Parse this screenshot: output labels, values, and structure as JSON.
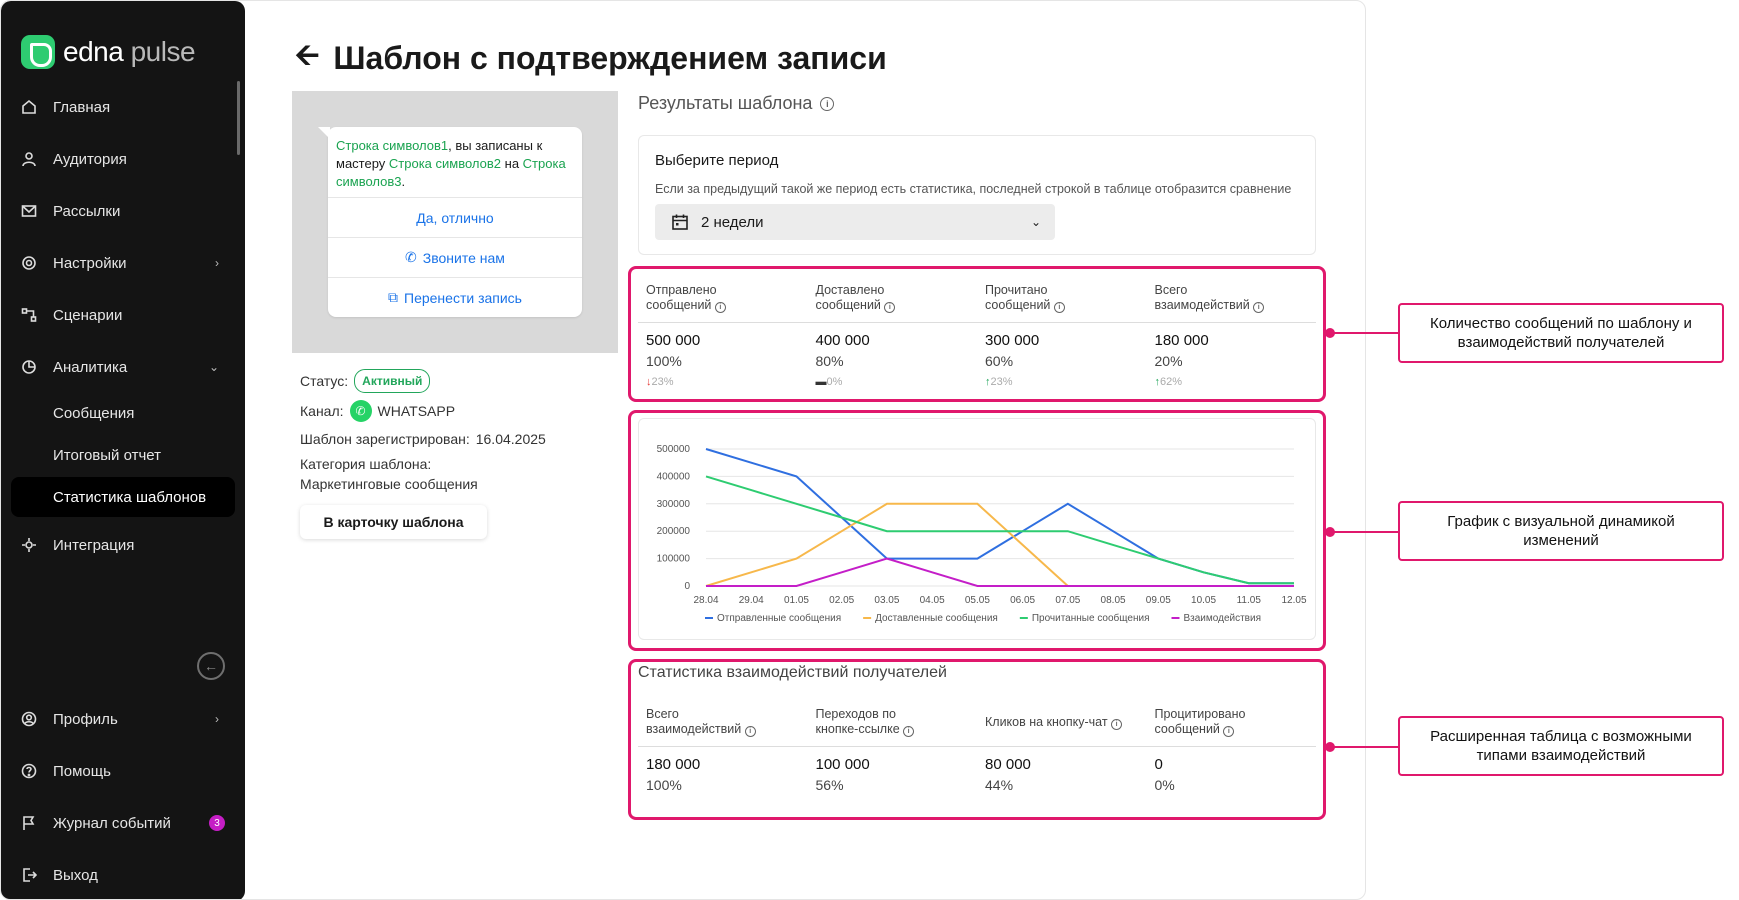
{
  "logo": {
    "brand": "edna",
    "product": "pulse"
  },
  "sidebar": {
    "items": [
      {
        "label": "Главная",
        "icon": "home-icon"
      },
      {
        "label": "Аудитория",
        "icon": "audience-icon"
      },
      {
        "label": "Рассылки",
        "icon": "mail-icon"
      },
      {
        "label": "Настройки",
        "icon": "settings-icon"
      },
      {
        "label": "Сценарии",
        "icon": "scenario-icon"
      },
      {
        "label": "Аналитика",
        "icon": "analytics-icon"
      },
      {
        "label": "Сообщения"
      },
      {
        "label": "Итоговый отчет"
      },
      {
        "label": "Статистика шаблонов"
      },
      {
        "label": "Интеграция",
        "icon": "integration-icon"
      }
    ],
    "bottom": [
      {
        "label": "Профиль",
        "icon": "profile-icon"
      },
      {
        "label": "Помощь",
        "icon": "help-icon"
      },
      {
        "label": "Журнал событий",
        "icon": "flag-icon",
        "badge": "3"
      },
      {
        "label": "Выход",
        "icon": "logout-icon"
      }
    ]
  },
  "page": {
    "title": "Шаблон с подтверждением записи"
  },
  "preview": {
    "text_parts": [
      "Строка символов1",
      ", вы записаны к мастеру ",
      "Строка символов2",
      " на ",
      "Строка символов3",
      "."
    ],
    "buttons": [
      "Да, отлично",
      "Звоните нам",
      "Перенести запись"
    ]
  },
  "info": {
    "status_label": "Статус:",
    "status_value": "Активный",
    "channel_label": "Канал:",
    "channel_value": "WHATSAPP",
    "registered_label": "Шаблон зарегистрирован:",
    "registered_value": "16.04.2025",
    "category_label": "Категория шаблона:",
    "category_value": "Маркетинговые сообщения",
    "card_button": "В карточку шаблона"
  },
  "results": {
    "title": "Результаты шаблона",
    "period_title": "Выберите период",
    "period_hint": "Если за предыдущий такой же период есть статистика, последней строкой в таблице отобразится сравнение",
    "period_value": "2 недели"
  },
  "metrics": [
    {
      "label1": "Отправлено",
      "label2": "сообщений",
      "value": "500 000",
      "pct": "100%",
      "delta": "23%",
      "dir": "down"
    },
    {
      "label1": "Доставлено",
      "label2": "сообщений",
      "value": "400 000",
      "pct": "80%",
      "delta": "0%",
      "dir": "flat"
    },
    {
      "label1": "Прочитано",
      "label2": "сообщений",
      "value": "300 000",
      "pct": "60%",
      "delta": "23%",
      "dir": "up"
    },
    {
      "label1": "Всего",
      "label2": "взаимодействий",
      "value": "180 000",
      "pct": "20%",
      "delta": "62%",
      "dir": "up"
    }
  ],
  "chart_data": {
    "type": "line",
    "categories": [
      "28.04",
      "29.04",
      "01.05",
      "02.05",
      "03.05",
      "04.05",
      "05.05",
      "06.05",
      "07.05",
      "08.05",
      "09.05",
      "10.05",
      "11.05",
      "12.05"
    ],
    "ylim": [
      0,
      500000
    ],
    "yticks": [
      "0",
      "100000",
      "200000",
      "300000",
      "400000",
      "500000"
    ],
    "grid": true,
    "legend": "bottom",
    "series": [
      {
        "name": "Отправленные сообщения",
        "color": "#2f6fe0",
        "values": [
          500000,
          450000,
          400000,
          250000,
          100000,
          100000,
          100000,
          200000,
          300000,
          200000,
          100000,
          50000,
          10000,
          10000
        ]
      },
      {
        "name": "Доставленные сообщения",
        "color": "#f7b84b",
        "values": [
          0,
          50000,
          100000,
          200000,
          300000,
          300000,
          300000,
          150000,
          0,
          0,
          0,
          0,
          0,
          0
        ]
      },
      {
        "name": "Прочитанные сообщения",
        "color": "#2ecc71",
        "values": [
          400000,
          350000,
          300000,
          250000,
          200000,
          200000,
          200000,
          200000,
          200000,
          150000,
          100000,
          50000,
          10000,
          10000
        ]
      },
      {
        "name": "Взаимодействия",
        "color": "#c41ec8",
        "values": [
          0,
          0,
          0,
          50000,
          100000,
          50000,
          0,
          0,
          0,
          0,
          0,
          0,
          0,
          0
        ]
      }
    ]
  },
  "interactions": {
    "title": "Статистика взаимодействий получателей",
    "cols": [
      {
        "label1": "Всего",
        "label2": "взаимодействий",
        "value": "180 000",
        "pct": "100%"
      },
      {
        "label1": "Переходов по",
        "label2": "кнопке-ссылке",
        "value": "100 000",
        "pct": "56%"
      },
      {
        "label1": "",
        "label2": "Кликов на кнопку-чат",
        "value": "80 000",
        "pct": "44%"
      },
      {
        "label1": "Процитировано",
        "label2": "сообщений",
        "value": "0",
        "pct": "0%"
      }
    ]
  },
  "callouts": [
    "Количество сообщений по шаблону и взаимодействий получателей",
    "График с визуальной динамикой изменений",
    "Расширенная таблица с возможными типами взаимодействий"
  ],
  "colors": {
    "accent": "#e0186c",
    "green": "#1aa350",
    "link": "#1a73e8"
  }
}
